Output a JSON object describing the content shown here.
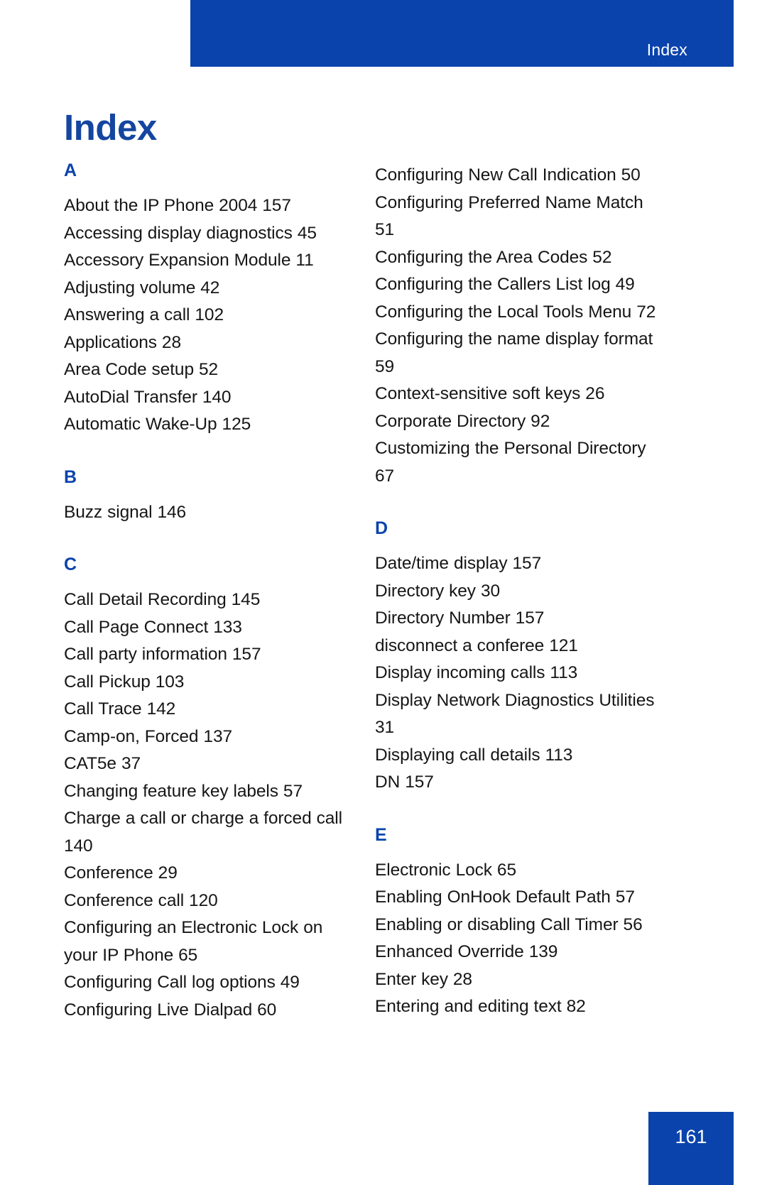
{
  "header": {
    "running_head": "Index"
  },
  "page_title": "Index",
  "footer": {
    "page_number": "161"
  },
  "colors": {
    "brand_blue": "#0A43AC",
    "title_blue": "#14459F",
    "body_text": "#161616",
    "page_background": "#FFFFFF"
  },
  "columns": [
    {
      "name": "left",
      "sections": [
        {
          "letter": "A",
          "entries": [
            "About the IP Phone 2004 157",
            "Accessing display diagnostics 45",
            "Accessory Expansion Module 11",
            "Adjusting volume 42",
            "Answering a call 102",
            "Applications 28",
            "Area Code setup 52",
            "AutoDial Transfer 140",
            "Automatic Wake-Up 125"
          ]
        },
        {
          "letter": "B",
          "entries": [
            "Buzz signal 146"
          ]
        },
        {
          "letter": "C",
          "entries": [
            "Call Detail Recording 145",
            "Call Page Connect 133",
            "Call party information 157",
            "Call Pickup 103",
            "Call Trace 142",
            "Camp-on, Forced 137",
            "CAT5e 37",
            "Changing feature key labels 57",
            "Charge a call or charge a forced call 140",
            "Conference 29",
            "Conference call 120",
            "Configuring an Electronic Lock on your IP Phone 65",
            "Configuring Call log options 49",
            "Configuring Live Dialpad 60"
          ]
        }
      ]
    },
    {
      "name": "right",
      "sections": [
        {
          "letter": "",
          "entries": [
            "Configuring New Call Indication 50",
            "Configuring Preferred Name Match 51",
            "Configuring the Area Codes 52",
            "Configuring the Callers List log 49",
            "Configuring the Local Tools Menu 72",
            "Configuring the name display format 59",
            "Context-sensitive soft keys 26",
            "Corporate Directory 92",
            "Customizing the Personal Directory 67"
          ]
        },
        {
          "letter": "D",
          "entries": [
            "Date/time display 157",
            "Directory key 30",
            "Directory Number 157",
            "disconnect a conferee 121",
            "Display incoming calls 113",
            "Display Network Diagnostics Utilities 31",
            "Displaying call details 113",
            "DN 157"
          ]
        },
        {
          "letter": "E",
          "entries": [
            "Electronic Lock 65",
            "Enabling OnHook Default Path 57",
            "Enabling or disabling Call Timer 56",
            "Enhanced Override 139",
            "Enter key 28",
            "Entering and editing text 82"
          ]
        }
      ]
    }
  ]
}
